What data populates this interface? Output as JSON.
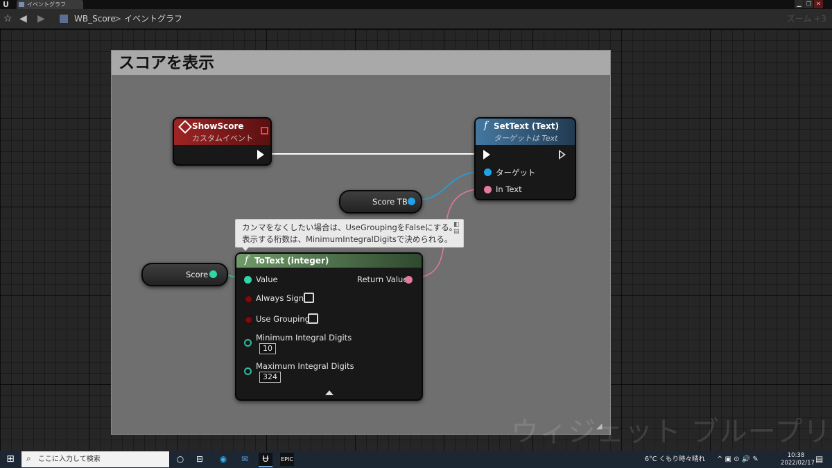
{
  "window": {
    "tab_title": "イベントグラフ",
    "controls": [
      "▁",
      "❐",
      "✕"
    ]
  },
  "toolbar": {
    "breadcrumb": [
      "WB_Score",
      "イベントグラフ"
    ],
    "breadcrumb_separator": ">",
    "zoom": "ズーム +3"
  },
  "graph": {
    "comment_title": "スコアを表示",
    "watermark": "ウィジェット ブループリント",
    "nodes": {
      "show_score": {
        "title": "ShowScore",
        "subtitle": "カスタムイベント",
        "header_color": "#8e2020"
      },
      "set_text": {
        "title": "SetText (Text)",
        "subtitle": "ターゲットは Text",
        "header_color": "#3a6a8c",
        "pins": {
          "target": "ターゲット",
          "in_text": "In Text"
        }
      },
      "score_tb": {
        "label": "Score TB",
        "pin_color": "#1fa3e6"
      },
      "score": {
        "label": "Score",
        "pin_color": "#2fd6a8"
      },
      "to_text": {
        "title": "ToText (integer)",
        "header_color": "#5f8a5a",
        "pins": {
          "value": "Value",
          "return_value": "Return Value",
          "always_sign": "Always Sign",
          "use_grouping": "Use Grouping",
          "min_digits": "Minimum Integral Digits",
          "min_digits_value": "10",
          "max_digits": "Maximum Integral Digits",
          "max_digits_value": "324"
        }
      }
    },
    "node_comment": {
      "line1": "カンマをなくしたい場合は、UseGroupingをFalseにする。",
      "line2": "表示する桁数は、MinimumIntegralDigitsで決められる。"
    },
    "wire_colors": {
      "exec": "#ffffff",
      "object": "#1fa3e6",
      "text": "#e47aa0",
      "int": "#2fd6a8"
    }
  },
  "taskbar": {
    "search_placeholder": "ここに入力して検索",
    "weather": "6°C くもり時々晴れ",
    "tray_icons": "^ ▣ ⊙ 🔊 ✎",
    "time": "10:38",
    "date": "2022/02/17"
  }
}
